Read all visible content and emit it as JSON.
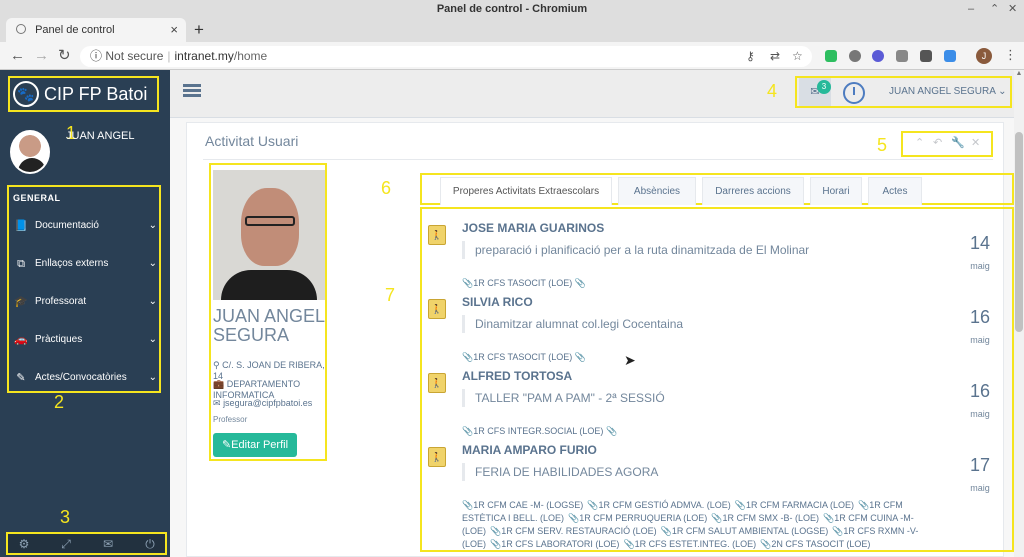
{
  "window": {
    "title": "Panel de control - Chromium"
  },
  "browser": {
    "tab_title": "Panel de control",
    "security": "Not secure",
    "url_host": "intranet.my",
    "url_path": "/home",
    "profile_initial": "J"
  },
  "brand": {
    "name": "CIP FP Batoi"
  },
  "sidebar": {
    "welcome": "JUAN ANGEL",
    "section_title": "GENERAL",
    "items": [
      {
        "label": "Documentació",
        "icon": "book-icon"
      },
      {
        "label": "Enllaços externs",
        "icon": "external-link-icon"
      },
      {
        "label": "Professorat",
        "icon": "graduation-cap-icon"
      },
      {
        "label": "Pràctiques",
        "icon": "car-icon"
      },
      {
        "label": "Actes/Convocatòries",
        "icon": "edit-icon"
      }
    ],
    "footer_icons": [
      "settings-icon",
      "fullscreen-icon",
      "mail-icon",
      "power-icon"
    ]
  },
  "annotations": [
    "1",
    "2",
    "3",
    "4",
    "5",
    "6",
    "7"
  ],
  "topnav": {
    "mail_count": "3",
    "user": "JUAN ANGEL SEGURA"
  },
  "panel": {
    "title": "Activitat Usuari"
  },
  "profile": {
    "name": "JUAN ANGEL SEGURA",
    "address": "C/. S. JOAN DE RIBERA, 14",
    "department": "DEPARTAMENTO INFORMATICA",
    "email": "jsegura@cipfpbatoi.es",
    "role": "Professor",
    "edit_label": "Editar Perfil"
  },
  "tabs": [
    {
      "label": "Properes Activitats Extraescolars",
      "active": true
    },
    {
      "label": "Absències",
      "active": false
    },
    {
      "label": "Darreres accions",
      "active": false
    },
    {
      "label": "Horari",
      "active": false
    },
    {
      "label": "Actes",
      "active": false
    }
  ],
  "activities": [
    {
      "name": "JOSE MARIA GUARINOS",
      "description": "preparació i planificació per a la ruta dinamitzada de El Molinar",
      "day": "14",
      "month": "maig",
      "tags": [
        "1R CFS TASOCIT (LOE)"
      ]
    },
    {
      "name": "SILVIA RICO",
      "description": "Dinamitzar alumnat col.legi Cocentaina",
      "day": "16",
      "month": "maig",
      "tags": [
        "1R CFS TASOCIT (LOE)"
      ]
    },
    {
      "name": "ALFRED TORTOSA",
      "description": "TALLER \"PAM A PAM\" - 2ª SESSIÓ",
      "day": "16",
      "month": "maig",
      "tags": [
        "1R CFS INTEGR.SOCIAL (LOE)"
      ]
    },
    {
      "name": "MARIA AMPARO FURIO",
      "description": "FERIA DE HABILIDADES AGORA",
      "day": "17",
      "month": "maig",
      "tags": [
        "1R CFM CAE -M- (LOGSE)",
        "1R CFM GESTIÓ ADMVA. (LOE)",
        "1R CFM FARMACIA (LOE)",
        "1R CFM ESTÈTICA I BELL. (LOE)",
        "1R CFM PERRUQUERIA (LOE)",
        "1R CFM SMX -B- (LOE)",
        "1R CFM CUINA -M- (LOE)",
        "1R CFM SERV. RESTAURACIÓ (LOE)",
        "1R CFM SALUT AMBIENTAL (LOGSE)",
        "1R CFS RXMN -V- (LOE)",
        "1R CFS LABORATORI (LOE)",
        "1R CFS ESTET.INTEG. (LOE)",
        "2N CFS TASOCIT (LOE)"
      ]
    }
  ],
  "colors": {
    "sidebar": "#2a3f54",
    "highlight": "#f5e51f",
    "accent": "#26b99a"
  }
}
